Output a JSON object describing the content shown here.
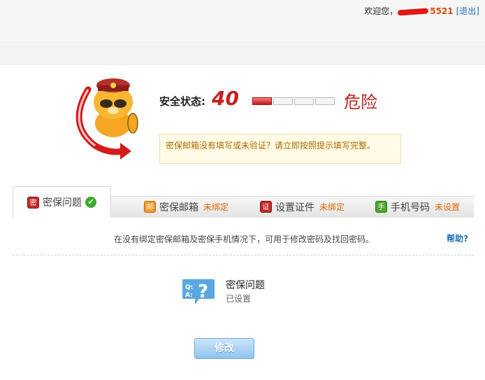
{
  "header": {
    "greeting": "欢迎您，",
    "username_visible": "5521",
    "logout": "[退出]"
  },
  "security": {
    "label": "安全状态:",
    "score": "40",
    "level": "危险",
    "bar_filled": 1,
    "bar_total": 4,
    "warning": "密保邮箱没有填写或未验证？请立即按照提示填写完整。"
  },
  "tabs": [
    {
      "label": "密保问题",
      "status": "",
      "icon": "seal-icon",
      "icon_glyph": "密",
      "completed": true
    },
    {
      "label": "密保邮箱",
      "status": "未绑定",
      "icon": "mail-icon",
      "icon_glyph": "邮"
    },
    {
      "label": "设置证件",
      "status": "未绑定",
      "icon": "id-card-icon",
      "icon_glyph": "证"
    },
    {
      "label": "手机号码",
      "status": "未设置",
      "icon": "phone-icon",
      "icon_glyph": "手"
    }
  ],
  "content": {
    "info": "在没有绑定密保邮箱及密保手机情况下，可用于修改密码及找回密码。",
    "help": "帮助?",
    "item_title": "密保问题",
    "item_status": "已设置",
    "modify_button": "修改"
  },
  "colors": {
    "danger": "#c62020",
    "link": "#1f6fb4",
    "status_orange": "#e06a00",
    "button_blue": "#8fc4f1"
  }
}
